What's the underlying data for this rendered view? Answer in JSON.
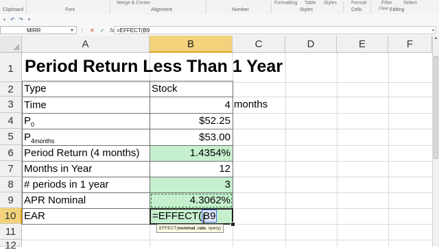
{
  "ribbon": {
    "groups": [
      "Clipboard",
      "Font",
      "Alignment",
      "Number",
      "Styles",
      "Cells",
      "Editing"
    ],
    "partial": [
      "Merge & Center",
      "Formatting",
      "Table",
      "Styles",
      "Format",
      "Filter",
      "Select"
    ],
    "clear_label": "Clear"
  },
  "formula_bar": {
    "name_box": "MIRR",
    "formula": "=EFFECT(B9"
  },
  "columns": [
    "A",
    "B",
    "C",
    "D",
    "E",
    "F"
  ],
  "rows": [
    "1",
    "2",
    "3",
    "4",
    "5",
    "6",
    "7",
    "8",
    "9",
    "10",
    "11",
    "12"
  ],
  "sheet": {
    "title": "Period Return Less Than 1 Year",
    "r2": {
      "a": "Type",
      "b": "Stock"
    },
    "r3": {
      "a": "Time",
      "b": "4",
      "c": "months"
    },
    "r4": {
      "a": "P",
      "a_sub": "0",
      "b": "$52.25"
    },
    "r5": {
      "a": "P",
      "a_sub": "4months",
      "b": "$53.00"
    },
    "r6": {
      "a": "Period Return (4 months)",
      "b": "1.4354%"
    },
    "r7": {
      "a": "Months in Year",
      "b": "12"
    },
    "r8": {
      "a": "# periods in 1 year",
      "b": "3"
    },
    "r9": {
      "a": "APR Nominal",
      "b": "4.3062%"
    },
    "r10": {
      "a": "EAR",
      "b_fn": "=EFFECT(",
      "b_ref": "B9"
    }
  },
  "tooltip": {
    "fn": "EFFECT(",
    "arg1": "nominal_rate",
    "rest": ", npery)"
  },
  "colors": {
    "green_fill": "#c6efce",
    "selected_header": "#f2d27a",
    "tooltip_bg": "#ffffe8"
  }
}
